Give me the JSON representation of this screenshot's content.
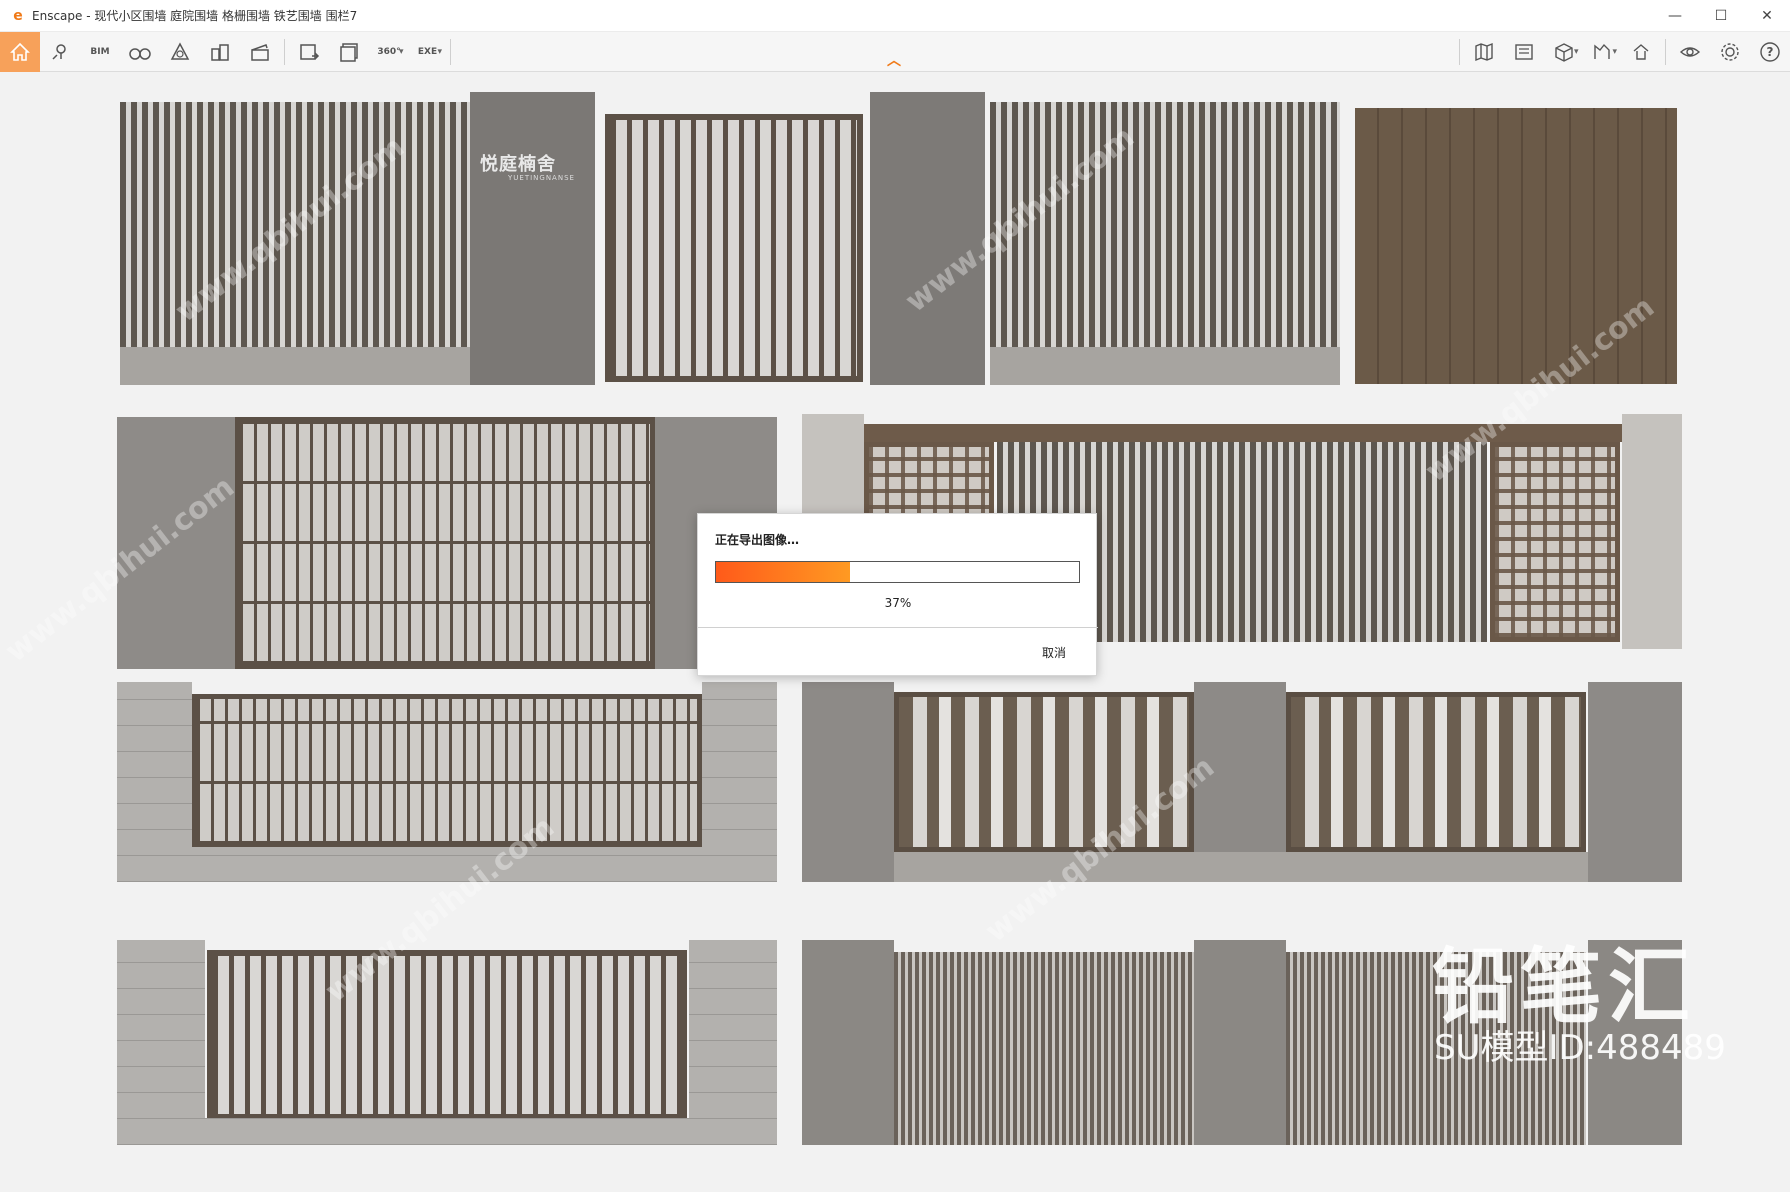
{
  "window": {
    "title": "Enscape - 现代小区围墙 庭院围墙 格栅围墙 铁艺围墙 围栏7",
    "minimize": "—",
    "maximize": "☐",
    "close": "✕"
  },
  "toolbar": {
    "bim_label": "BIM",
    "label_360": "360°",
    "exe_label": "EXE",
    "help_label": "?"
  },
  "scene": {
    "gate_sign": "悦庭楠舍",
    "gate_sign_sub": "YUETINGNANSE",
    "logo_text": "铅笔汇",
    "logo_id": "SU模型ID:488489"
  },
  "dialog": {
    "title": "正在导出图像…",
    "progress": 0.37,
    "progress_text": "37%",
    "cancel_label": "取消"
  },
  "colors": {
    "accent": "#f07a18",
    "progress_start": "#ff5a1a",
    "progress_end": "#ff9a22"
  }
}
